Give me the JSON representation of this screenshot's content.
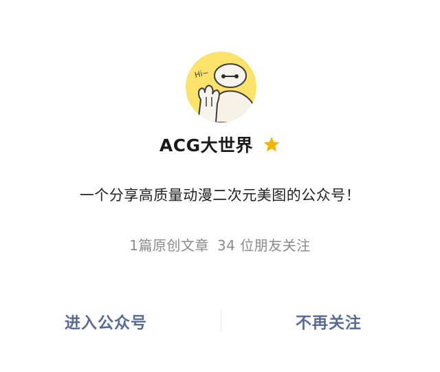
{
  "account": {
    "name": "ACG大世界",
    "starred": true,
    "intro": "一个分享高质量动漫二次元美图的公众号！",
    "stats": {
      "original_articles": "1篇原创文章",
      "friends_following": "34 位朋友关注"
    },
    "avatar": {
      "text": "Hi~",
      "icon": "baymax-avatar"
    }
  },
  "actions": {
    "enter_label": "进入公众号",
    "unfollow_label": "不再关注"
  },
  "colors": {
    "action_blue": "#576b95",
    "star": "#f5b400",
    "muted": "#8a8a8a",
    "avatar_bg": "#fbe26a"
  }
}
